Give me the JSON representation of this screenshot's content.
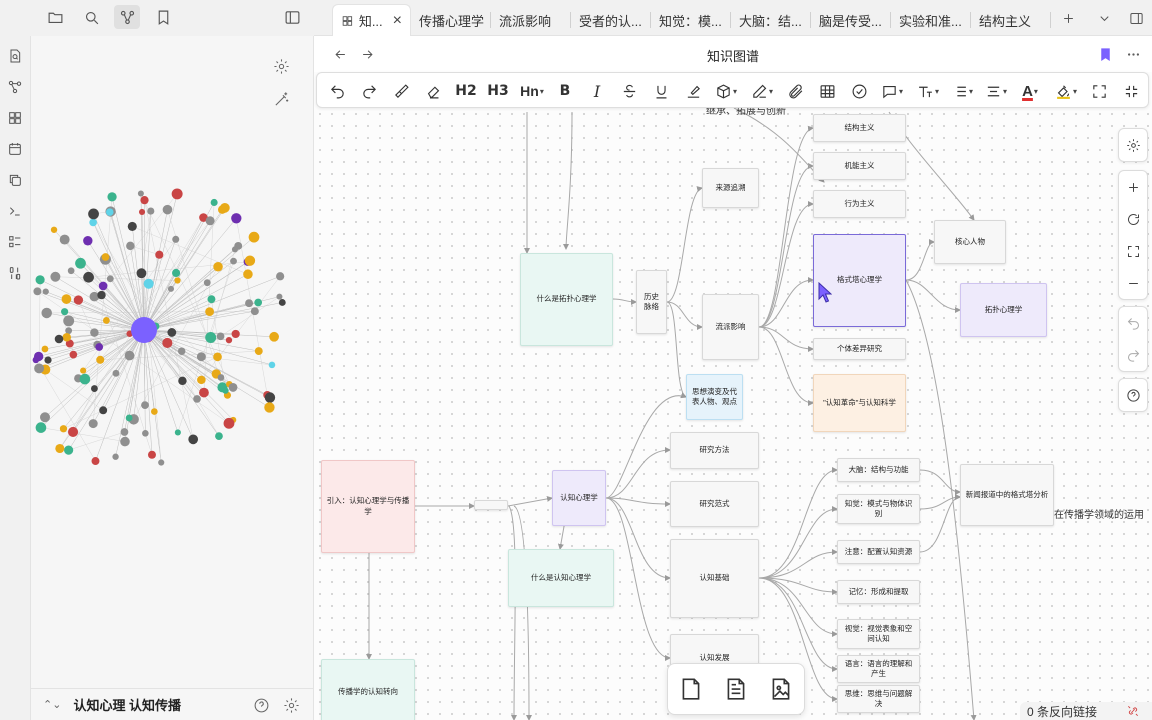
{
  "tabs": [
    {
      "label": "知..."
    },
    {
      "label": "传播心理学"
    },
    {
      "label": "流派影响"
    },
    {
      "label": "受者的认..."
    },
    {
      "label": "知觉：模..."
    },
    {
      "label": "大脑：结..."
    },
    {
      "label": "脑是传受..."
    },
    {
      "label": "实验和准..."
    },
    {
      "label": "结构主义"
    }
  ],
  "view": {
    "title": "知识图谱"
  },
  "toolbar": {
    "h2": "H2",
    "h3": "H3",
    "hn": "Hn",
    "bold": "B",
    "italic": "I",
    "font_color": "A"
  },
  "sidepanel": {
    "footer_title": "认知心理 认知传播"
  },
  "status": {
    "backlinks": "0 条反向链接"
  },
  "canvas": {
    "snippet_top": "继承、拓展与创新",
    "side_text": "在传播学领域的运用",
    "nodes": [
      {
        "label": "结构主义"
      },
      {
        "label": "机能主义"
      },
      {
        "label": "行为主义"
      },
      {
        "label": "来源追溯"
      },
      {
        "label": "核心人物"
      },
      {
        "label": "什么是拓扑心理学"
      },
      {
        "label": "历史脉络"
      },
      {
        "label": "流派影响"
      },
      {
        "label": "格式塔心理学"
      },
      {
        "label": "拓扑心理学"
      },
      {
        "label": "个体差异研究"
      },
      {
        "label": "思想演变及代表人物、观点"
      },
      {
        "label": "\"认知革命\"与认知科学"
      },
      {
        "label": "研究方法"
      },
      {
        "label": "大脑：结构与功能"
      },
      {
        "label": "新闻报道中的格式塔分析"
      },
      {
        "label": "引入：认知心理学与传播学"
      },
      {
        "label": "认知心理学"
      },
      {
        "label": "研究范式"
      },
      {
        "label": "知觉：模式与物体识别"
      },
      {
        "label": "什么是认知心理学"
      },
      {
        "label": "注意：配置认知资源"
      },
      {
        "label": "认知基础"
      },
      {
        "label": "记忆：形成和提取"
      },
      {
        "label": "视觉：视觉表象和空间认知"
      },
      {
        "label": "认知发展"
      },
      {
        "label": "语言：语言的理解和产生"
      },
      {
        "label": "思维：思维与问题解决"
      },
      {
        "label": "传播学的认知转向"
      }
    ]
  },
  "graph_colors": {
    "grey": "#8f8f8f",
    "dark": "#444444",
    "green": "#3bb38d",
    "yellow": "#e8a917",
    "red": "#c94545",
    "purple": "#6e2fb0",
    "cyan": "#5fd3e8",
    "pink": "#e23fae",
    "center": "#7b61ff"
  },
  "icons": {
    "ribbon": [
      "file-search-icon",
      "graph-icon",
      "blocks-icon",
      "calendar-icon",
      "copy-icon",
      "terminal-icon",
      "list-icon",
      "binary-icon"
    ],
    "topleft": [
      "folder-icon",
      "search-icon",
      "graph-view-icon",
      "bookmark-icon",
      "sidebar-toggle-icon"
    ]
  }
}
